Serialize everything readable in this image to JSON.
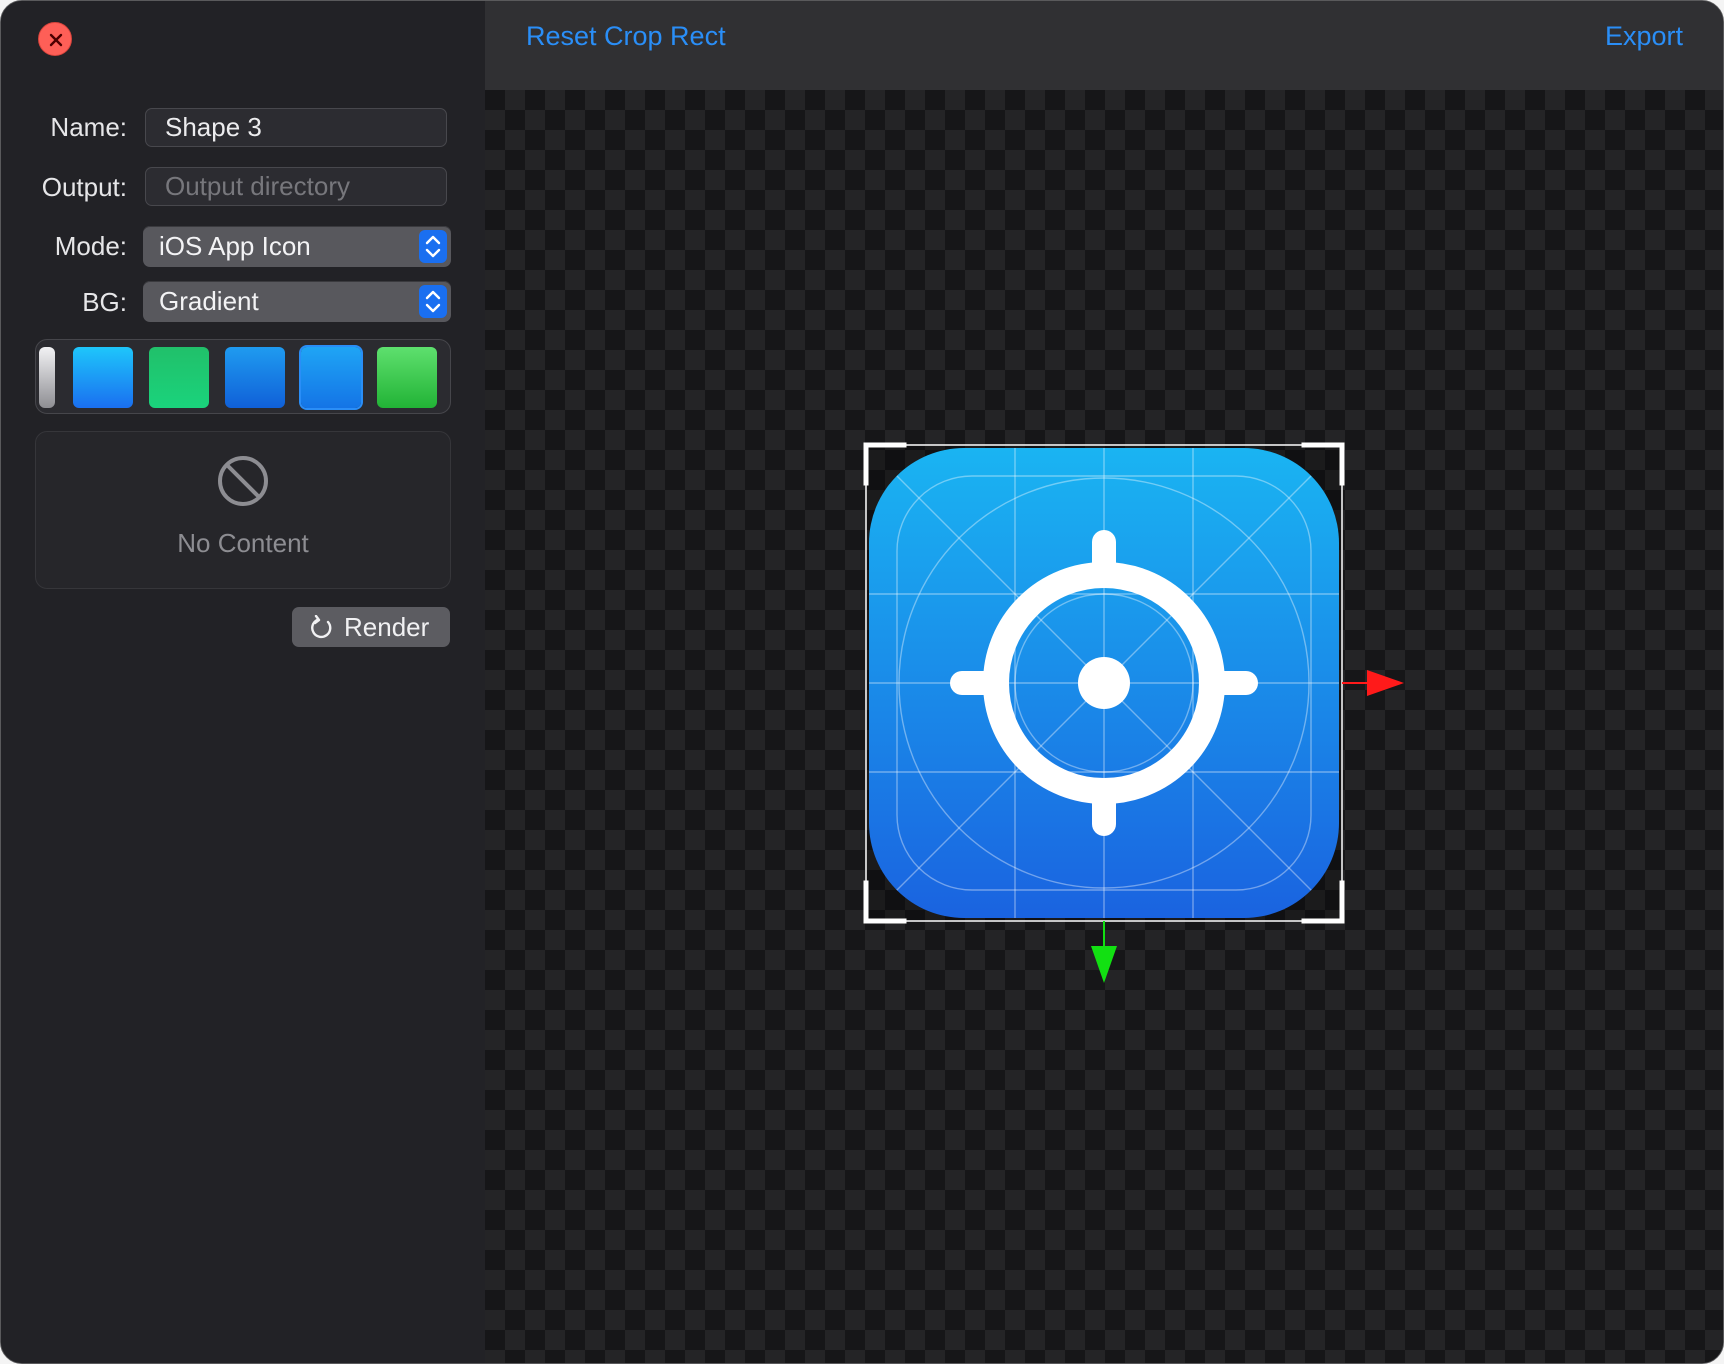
{
  "window": {
    "close_icon": "close-x-icon"
  },
  "sidebar": {
    "name": {
      "label": "Name:",
      "value": "Shape 3"
    },
    "output": {
      "label": "Output:",
      "value": "",
      "placeholder": "Output directory"
    },
    "mode": {
      "label": "Mode:",
      "selected": "iOS App Icon"
    },
    "bg": {
      "label": "BG:",
      "selected": "Gradient"
    },
    "swatches": [
      {
        "name": "gray-gradient",
        "colors": [
          "#f2f2f4",
          "#8e8e93"
        ]
      },
      {
        "name": "blue-cyan-gradient",
        "colors": [
          "#1ec6fb",
          "#1a6ff0"
        ]
      },
      {
        "name": "green-teal-gradient",
        "colors": [
          "#21c06a",
          "#1ad37c"
        ]
      },
      {
        "name": "blue-gradient",
        "colors": [
          "#1f9bf0",
          "#1060d8"
        ]
      },
      {
        "name": "sky-blue-gradient",
        "colors": [
          "#1fa5f5",
          "#1474e6"
        ],
        "selected": true
      },
      {
        "name": "green-gradient",
        "colors": [
          "#5ee06e",
          "#22b336"
        ]
      }
    ],
    "content": {
      "text": "No Content",
      "icon": "prohibited-icon"
    },
    "render_button": {
      "label": "Render",
      "icon": "refresh-icon"
    }
  },
  "toolbar": {
    "reset_label": "Reset Crop Rect",
    "export_label": "Export"
  },
  "canvas": {
    "preview_icon": "crosshair-app-icon",
    "icon_gradient": [
      "#1ab4f2",
      "#1a63e0"
    ],
    "axis_x_color": "#ff1a1a",
    "axis_y_color": "#12e012"
  },
  "colors": {
    "accent": "#2a8ef7",
    "close": "#fe5f57"
  }
}
